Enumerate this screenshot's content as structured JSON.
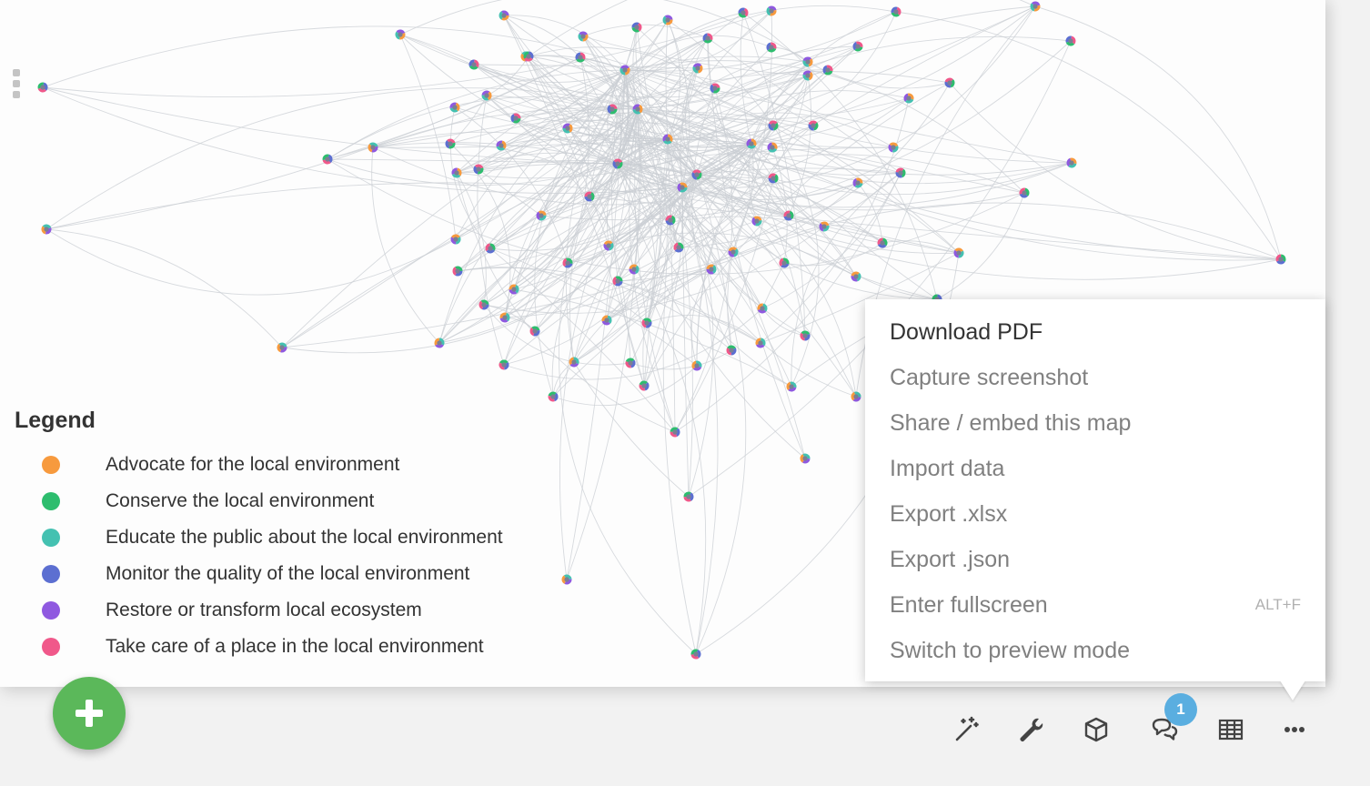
{
  "legend": {
    "title": "Legend",
    "items": [
      {
        "label": "Advocate for the local environment",
        "color": "#f79a3e"
      },
      {
        "label": "Conserve the local environment",
        "color": "#2dbd6e"
      },
      {
        "label": "Educate the public about the local environment",
        "color": "#44c1b1"
      },
      {
        "label": "Monitor the quality of the local environment",
        "color": "#5c6fd1"
      },
      {
        "label": "Restore or transform local ecosystem",
        "color": "#8f59e0"
      },
      {
        "label": "Take care of a place in the local environment",
        "color": "#f0588a"
      }
    ]
  },
  "menu": {
    "items": [
      {
        "label": "Download PDF",
        "shortcut": ""
      },
      {
        "label": "Capture screenshot",
        "shortcut": ""
      },
      {
        "label": "Share / embed this map",
        "shortcut": ""
      },
      {
        "label": "Import data",
        "shortcut": ""
      },
      {
        "label": "Export .xlsx",
        "shortcut": ""
      },
      {
        "label": "Export .json",
        "shortcut": ""
      },
      {
        "label": "Enter fullscreen",
        "shortcut": "ALT+F"
      },
      {
        "label": "Switch to preview mode",
        "shortcut": ""
      }
    ]
  },
  "toolbar": {
    "icons": [
      "magic-wand-icon",
      "wrench-icon",
      "cube-icon",
      "comments-icon",
      "table-icon",
      "more-icon"
    ],
    "comments_badge": "1",
    "icon_color": "#444444"
  },
  "add_button": {
    "icon": "plus-icon",
    "color": "#5bb85a"
  },
  "network": {
    "edge_color": "#c9cdd3"
  }
}
